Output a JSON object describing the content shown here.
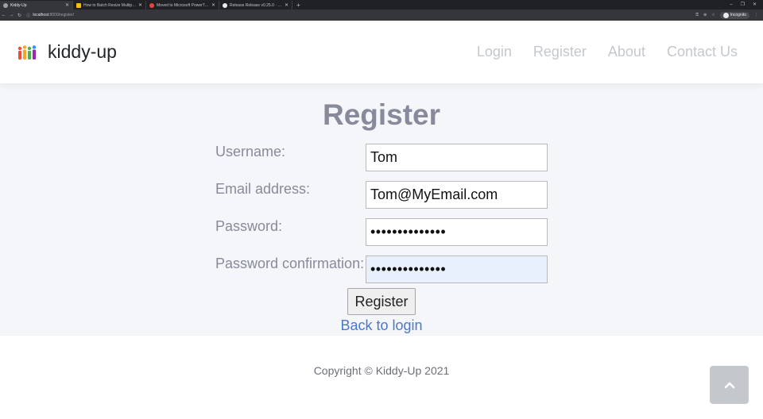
{
  "browser": {
    "tabs": [
      {
        "title": "Kiddy-Up",
        "icon_color": "#9aa0a6",
        "active": true
      },
      {
        "title": "How to Batch Resize Multiple Im",
        "icon_color": "#fbbc04",
        "active": false
      },
      {
        "title": "Moved to Microsoft PowerToys",
        "icon_color": "#e8453c",
        "active": false
      },
      {
        "title": "Release Release v0.25.0 · micros",
        "icon_color": "#e8eaed",
        "active": false
      }
    ],
    "new_tab": "+",
    "url_host": "localhost",
    "url_path": ":8000/register/",
    "incognito_label": "Incognito",
    "window_controls": [
      "–",
      "❐",
      "✕"
    ]
  },
  "header": {
    "brand": "kiddy-up",
    "nav": [
      "Login",
      "Register",
      "About",
      "Contact Us"
    ]
  },
  "form": {
    "title": "Register",
    "fields": [
      {
        "label": "Username:",
        "value": "Tom",
        "type": "text"
      },
      {
        "label": "Email address:",
        "value": "Tom@MyEmail.com",
        "type": "text"
      },
      {
        "label": "Password:",
        "value": "••••••••••••••",
        "type": "password"
      },
      {
        "label": "Password confirmation:",
        "value": "••••••••••••••",
        "type": "password"
      }
    ],
    "submit_label": "Register",
    "back_link": "Back to login"
  },
  "footer": {
    "copyright": "Copyright © Kiddy-Up 2021"
  },
  "colors": {
    "accent_link": "#4b78c9",
    "nav_text": "#c4c8cc",
    "main_bg": "#f4f6fa",
    "autofill_bg": "#e8f0fe"
  }
}
